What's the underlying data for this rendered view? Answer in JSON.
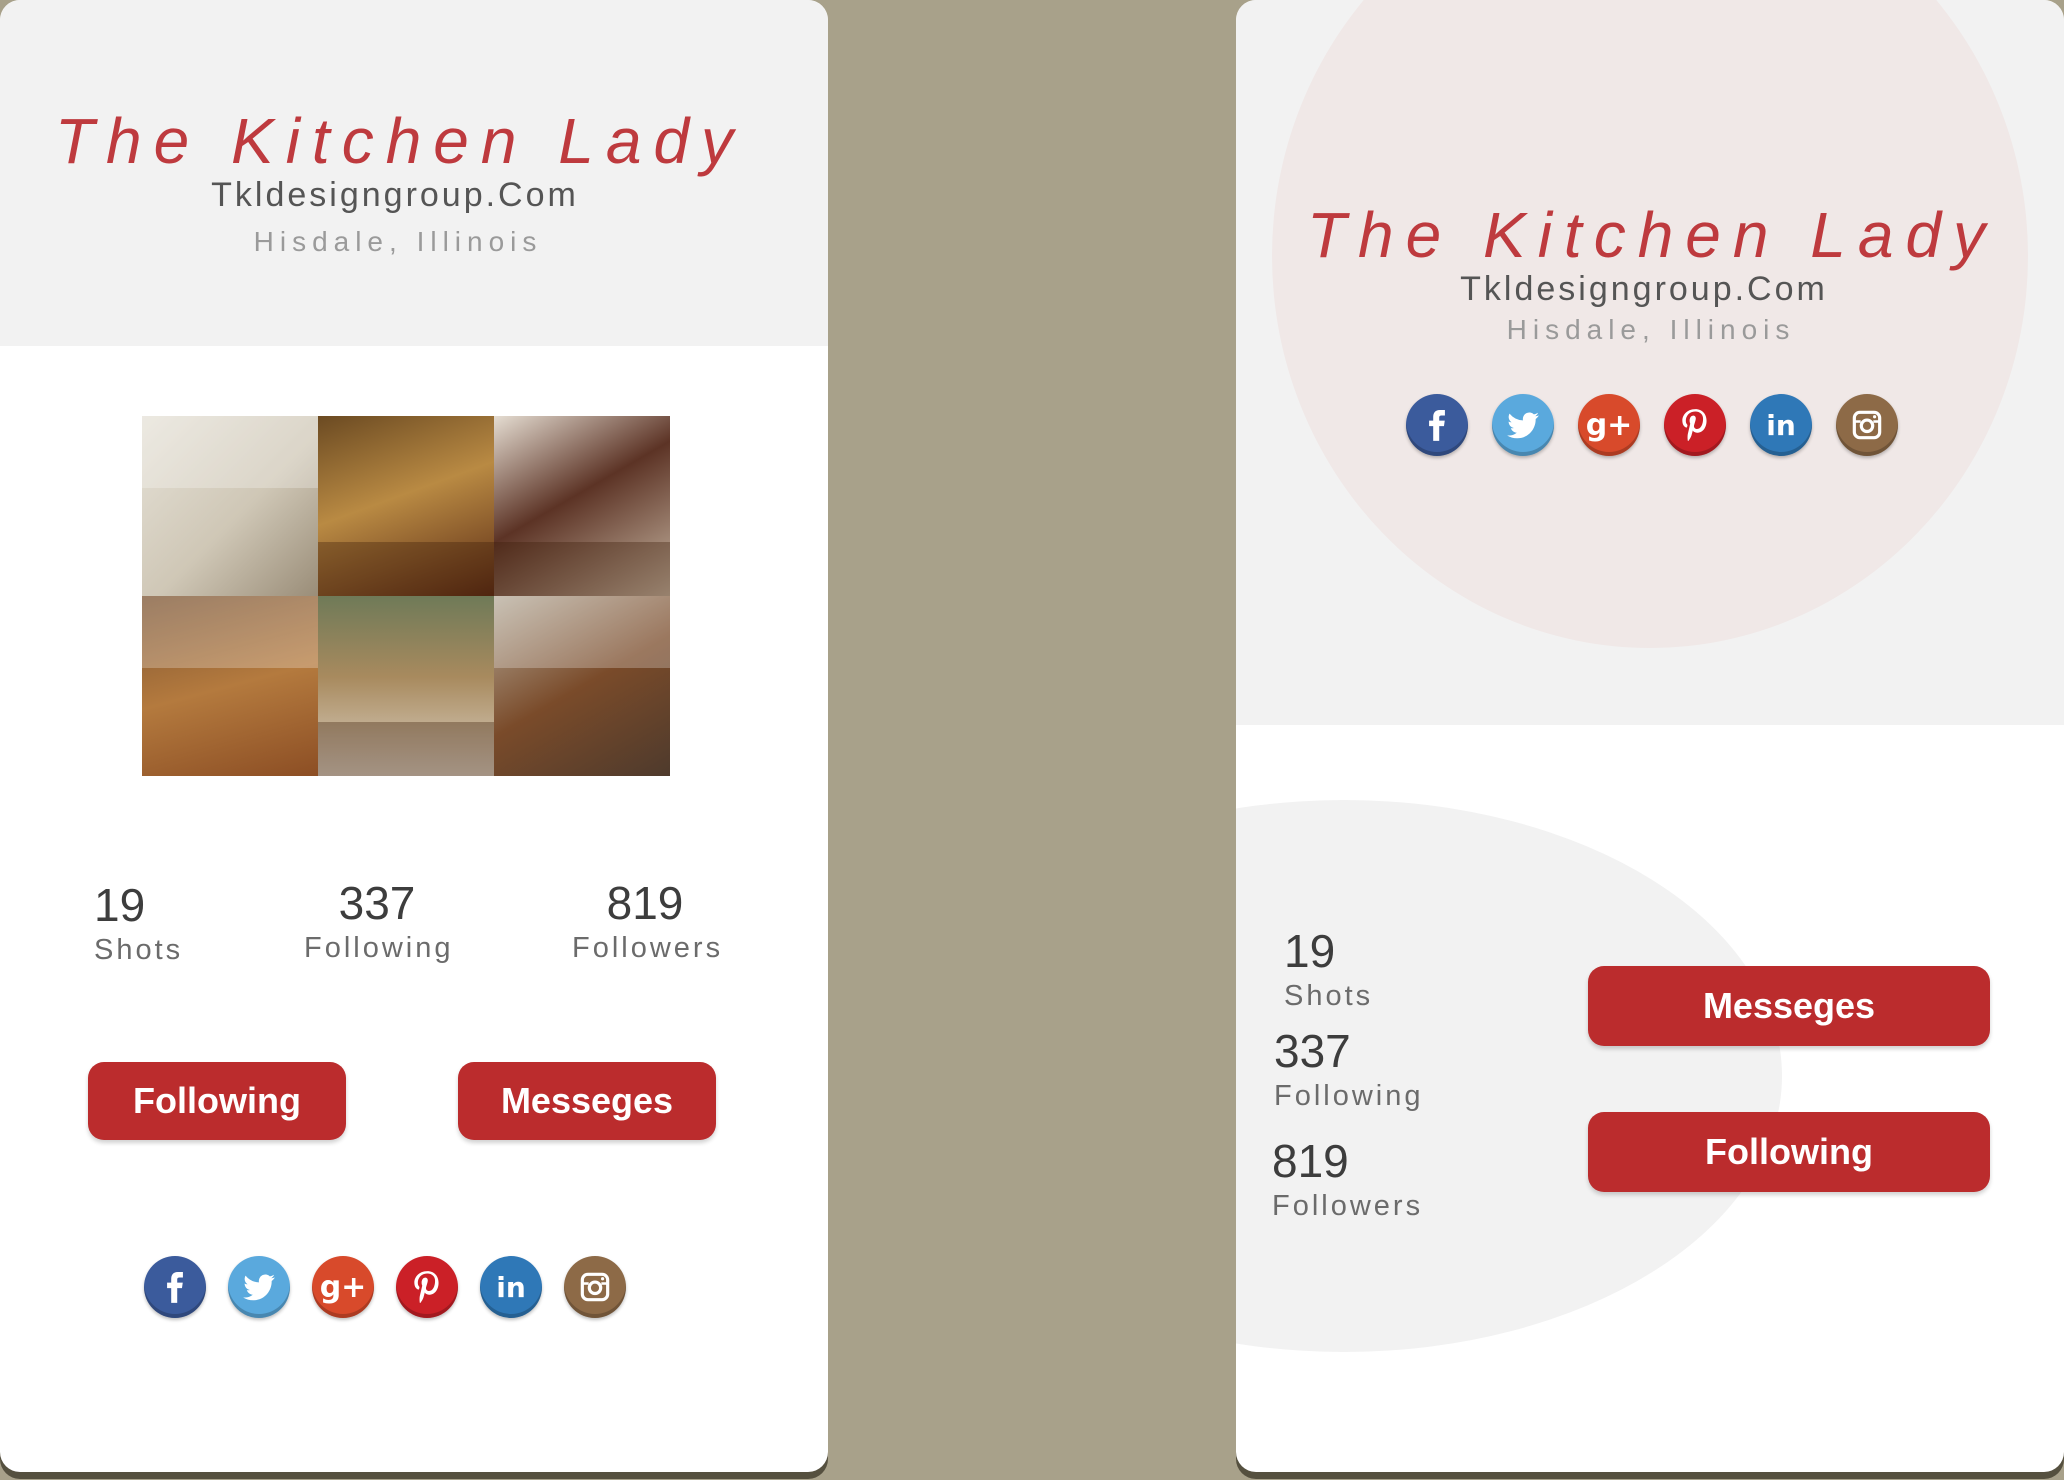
{
  "profile": {
    "name": "The Kitchen Lady",
    "website": "Tkldesigngroup.Com",
    "location": "Hisdale, Illinois"
  },
  "stats": {
    "shots": {
      "value": "19",
      "label": "Shots"
    },
    "following": {
      "value": "337",
      "label": "Following"
    },
    "followers": {
      "value": "819",
      "label": "Followers"
    }
  },
  "buttons": {
    "following": "Following",
    "messages": "Messeges"
  },
  "social": [
    {
      "icon": "facebook-icon",
      "color": "#3b5b9c"
    },
    {
      "icon": "twitter-icon",
      "color": "#5aa9dd"
    },
    {
      "icon": "google-plus-icon",
      "color": "#d84a2b"
    },
    {
      "icon": "pinterest-icon",
      "color": "#cb2027"
    },
    {
      "icon": "linkedin-icon",
      "color": "#2f78b7"
    },
    {
      "icon": "instagram-icon",
      "color": "#8d6a47"
    }
  ],
  "colors": {
    "accent": "#bb2c2d",
    "title": "#be3a3e",
    "background": "#a8a18a",
    "header": "#f2f2f2",
    "circle": "#f0e8e7"
  }
}
